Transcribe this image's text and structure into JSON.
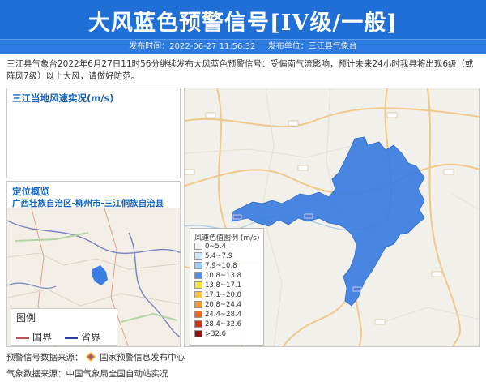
{
  "banner": {
    "title": "大风蓝色预警信号[IV级/一般]",
    "publish_time": "发布时间：2022-06-27 11:56:32",
    "publisher": "发布单位：三江县气象台"
  },
  "description": "三江县气象台2022年6月27日11时56分继续发布大风蓝色预警信号：受偏南气流影响，预计未来24小时我县将出现6级（或阵风7级）以上大风，请做好防范。",
  "wind_panel": {
    "title": "三江当地风速实况(m/s)"
  },
  "locate_panel": {
    "title": "定位概览",
    "subtitle": "广西壮族自治区-柳州市-三江侗族自治县",
    "legend_title": "图例",
    "legend_items": [
      {
        "label": "国界",
        "color": "#c0505a"
      },
      {
        "label": "省界",
        "color": "#2a3a9c"
      }
    ]
  },
  "wind_legend": {
    "title": "风速色值图例 (m/s)",
    "items": [
      {
        "label": "0~5.4",
        "color": "#f2f2f2"
      },
      {
        "label": "5.4~7.9",
        "color": "#cfe6fb"
      },
      {
        "label": "7.9~10.8",
        "color": "#9ccbf3"
      },
      {
        "label": "10.8~13.8",
        "color": "#4f8fe6"
      },
      {
        "label": "13.8~17.1",
        "color": "#f6e43a"
      },
      {
        "label": "17.1~20.8",
        "color": "#f5c542"
      },
      {
        "label": "20.8~24.4",
        "color": "#f29b2c"
      },
      {
        "label": "24.4~28.4",
        "color": "#ec6b22"
      },
      {
        "label": "28.4~32.6",
        "color": "#c8321e"
      },
      {
        "label": ">32.6",
        "color": "#8e1a12"
      }
    ]
  },
  "footer": {
    "warning_source_label": "预警信号数据来源：",
    "warning_source": "国家预警信息发布中心",
    "weather_source": "气象数据来源：中国气象局全国自动站实况"
  },
  "colors": {
    "banner_bg": "#1f6fd6",
    "alert_area": "#3a7de0",
    "title_blue": "#1565c0"
  }
}
